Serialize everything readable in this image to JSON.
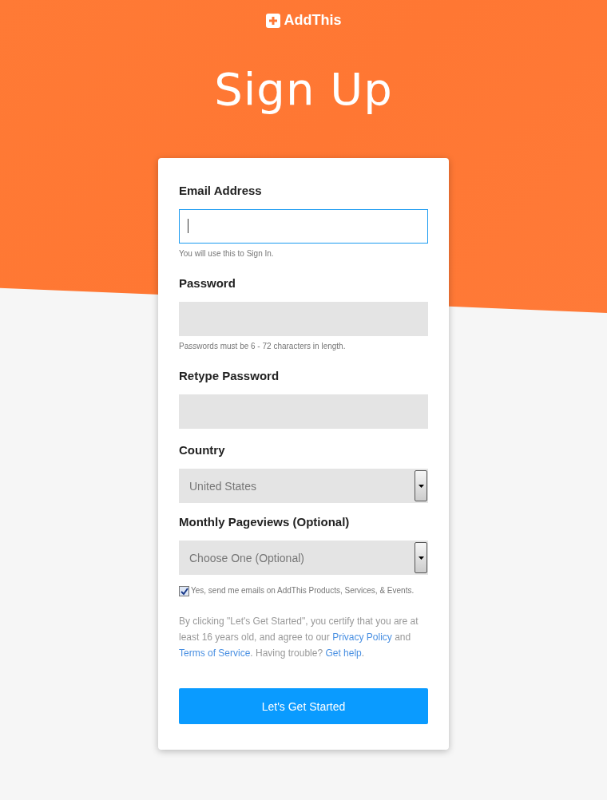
{
  "brand": {
    "name": "AddThis"
  },
  "heading": "Sign Up",
  "fields": [
    {
      "kind": "text",
      "label": "Email Address",
      "focused": true,
      "hint": "You will use this to Sign In."
    },
    {
      "kind": "text",
      "label": "Password",
      "focused": false,
      "hint": "Passwords must be 6 - 72 characters in length."
    },
    {
      "kind": "text",
      "label": "Retype Password",
      "focused": false
    },
    {
      "kind": "select",
      "label": "Country",
      "value": "United States"
    },
    {
      "kind": "select",
      "label": "Monthly Pageviews (Optional)",
      "value": "Choose One (Optional)"
    }
  ],
  "newsletter": {
    "checked": true,
    "label": "Yes, send me emails on AddThis Products, Services, & Events."
  },
  "terms": [
    {
      "text": "By clicking \"Let's Get Started\", you certify that you are at least 16 years old, and agree to our ",
      "link": false
    },
    {
      "text": "Privacy Policy",
      "link": true
    },
    {
      "text": " and ",
      "link": false
    },
    {
      "text": "Terms of Service",
      "link": true
    },
    {
      "text": ". Having trouble? ",
      "link": false
    },
    {
      "text": "Get help",
      "link": true
    },
    {
      "text": ".",
      "link": false
    }
  ],
  "submit": "Let's Get Started"
}
